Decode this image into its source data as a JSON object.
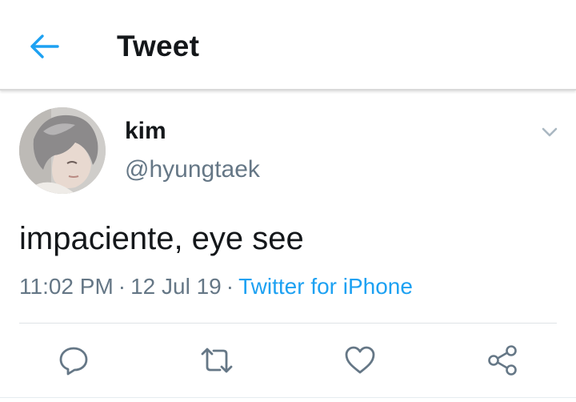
{
  "header": {
    "title": "Tweet",
    "back_icon": "arrow-left-icon"
  },
  "tweet": {
    "author_name": "kim",
    "author_handle": "@hyungtaek",
    "text": "impaciente, eye see",
    "time": "11:02 PM",
    "date": "12 Jul 19",
    "separator": "·",
    "source": "Twitter for iPhone"
  },
  "actions": {
    "icons": [
      "reply-icon",
      "retweet-icon",
      "like-icon",
      "share-icon"
    ]
  },
  "colors": {
    "accent": "#1da1f2",
    "secondary_text": "#657786",
    "primary_text": "#14171a",
    "icon_gray": "#657786"
  }
}
